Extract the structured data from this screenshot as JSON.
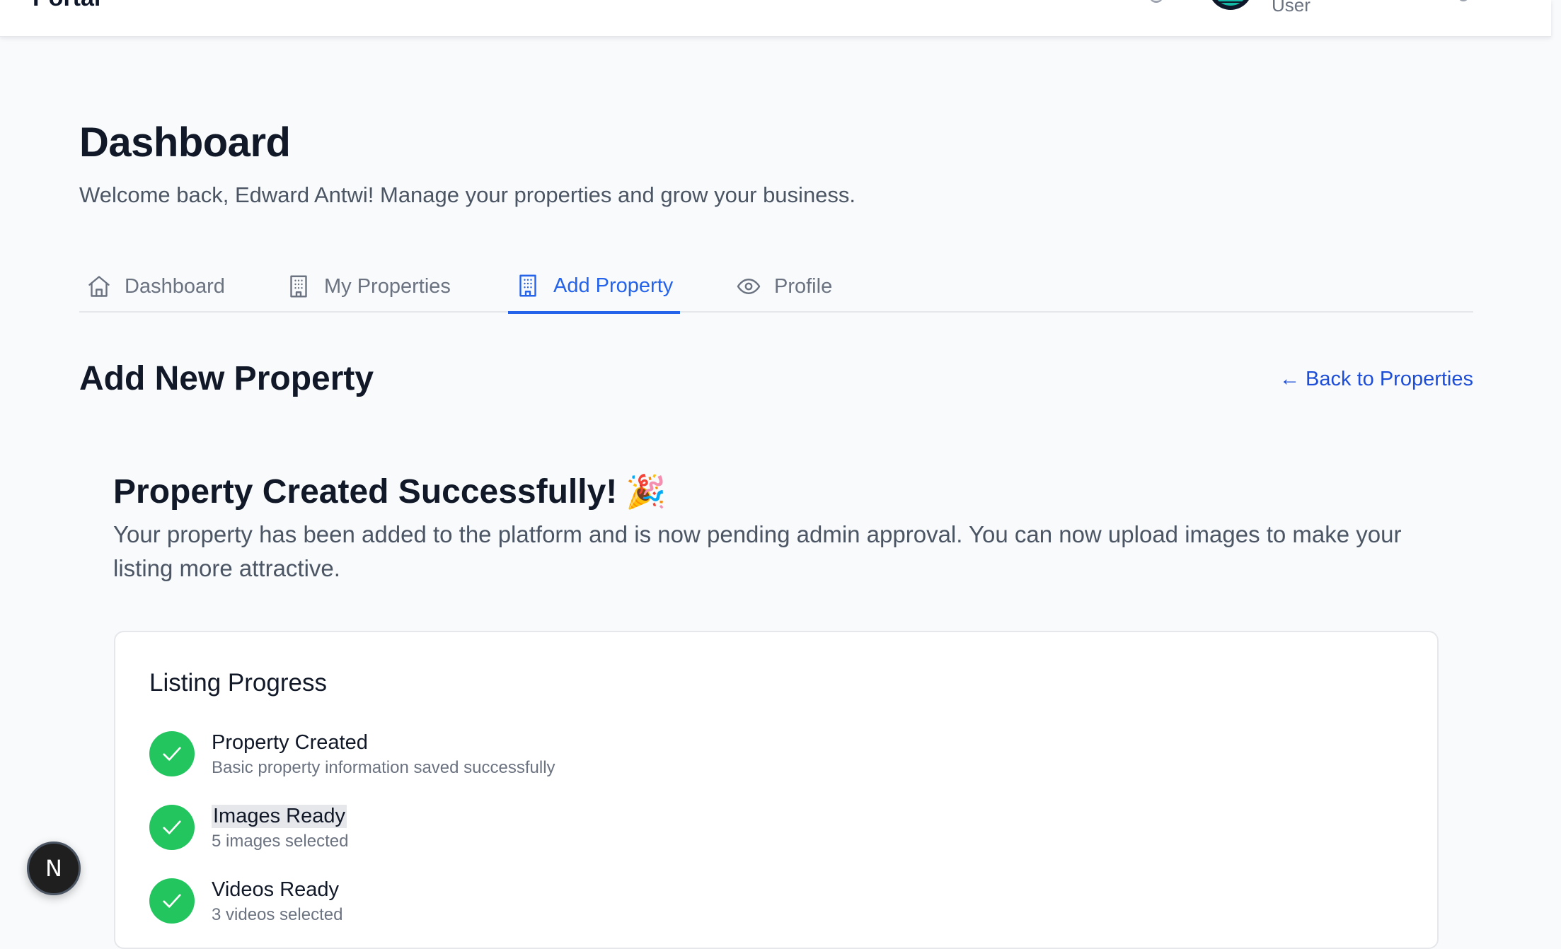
{
  "header": {
    "brand": "Portal",
    "user_role": "User"
  },
  "page": {
    "title": "Dashboard",
    "welcome": "Welcome back, Edward Antwi! Manage your properties and grow your business."
  },
  "tabs": [
    {
      "label": "Dashboard",
      "icon": "home-icon",
      "active": false
    },
    {
      "label": "My Properties",
      "icon": "building-icon",
      "active": false
    },
    {
      "label": "Add Property",
      "icon": "building-icon",
      "active": true
    },
    {
      "label": "Profile",
      "icon": "eye-icon",
      "active": false
    }
  ],
  "section": {
    "title": "Add New Property",
    "back_link": "← Back to Properties"
  },
  "success": {
    "title": "Property Created Successfully!",
    "emoji": "🎉",
    "message": "Your property has been added to the platform and is now pending admin approval. You can now upload images to make your listing more attractive."
  },
  "progress": {
    "title": "Listing Progress",
    "steps": [
      {
        "label": "Property Created",
        "description": "Basic property information saved successfully",
        "complete": true
      },
      {
        "label": "Images Ready",
        "description": "5 images selected",
        "complete": true
      },
      {
        "label": "Videos Ready",
        "description": "3 videos selected",
        "complete": true
      }
    ]
  },
  "dev_badge": {
    "label": "N"
  },
  "colors": {
    "accent": "#2563eb",
    "success": "#22c55e",
    "background": "#f8fafc"
  }
}
